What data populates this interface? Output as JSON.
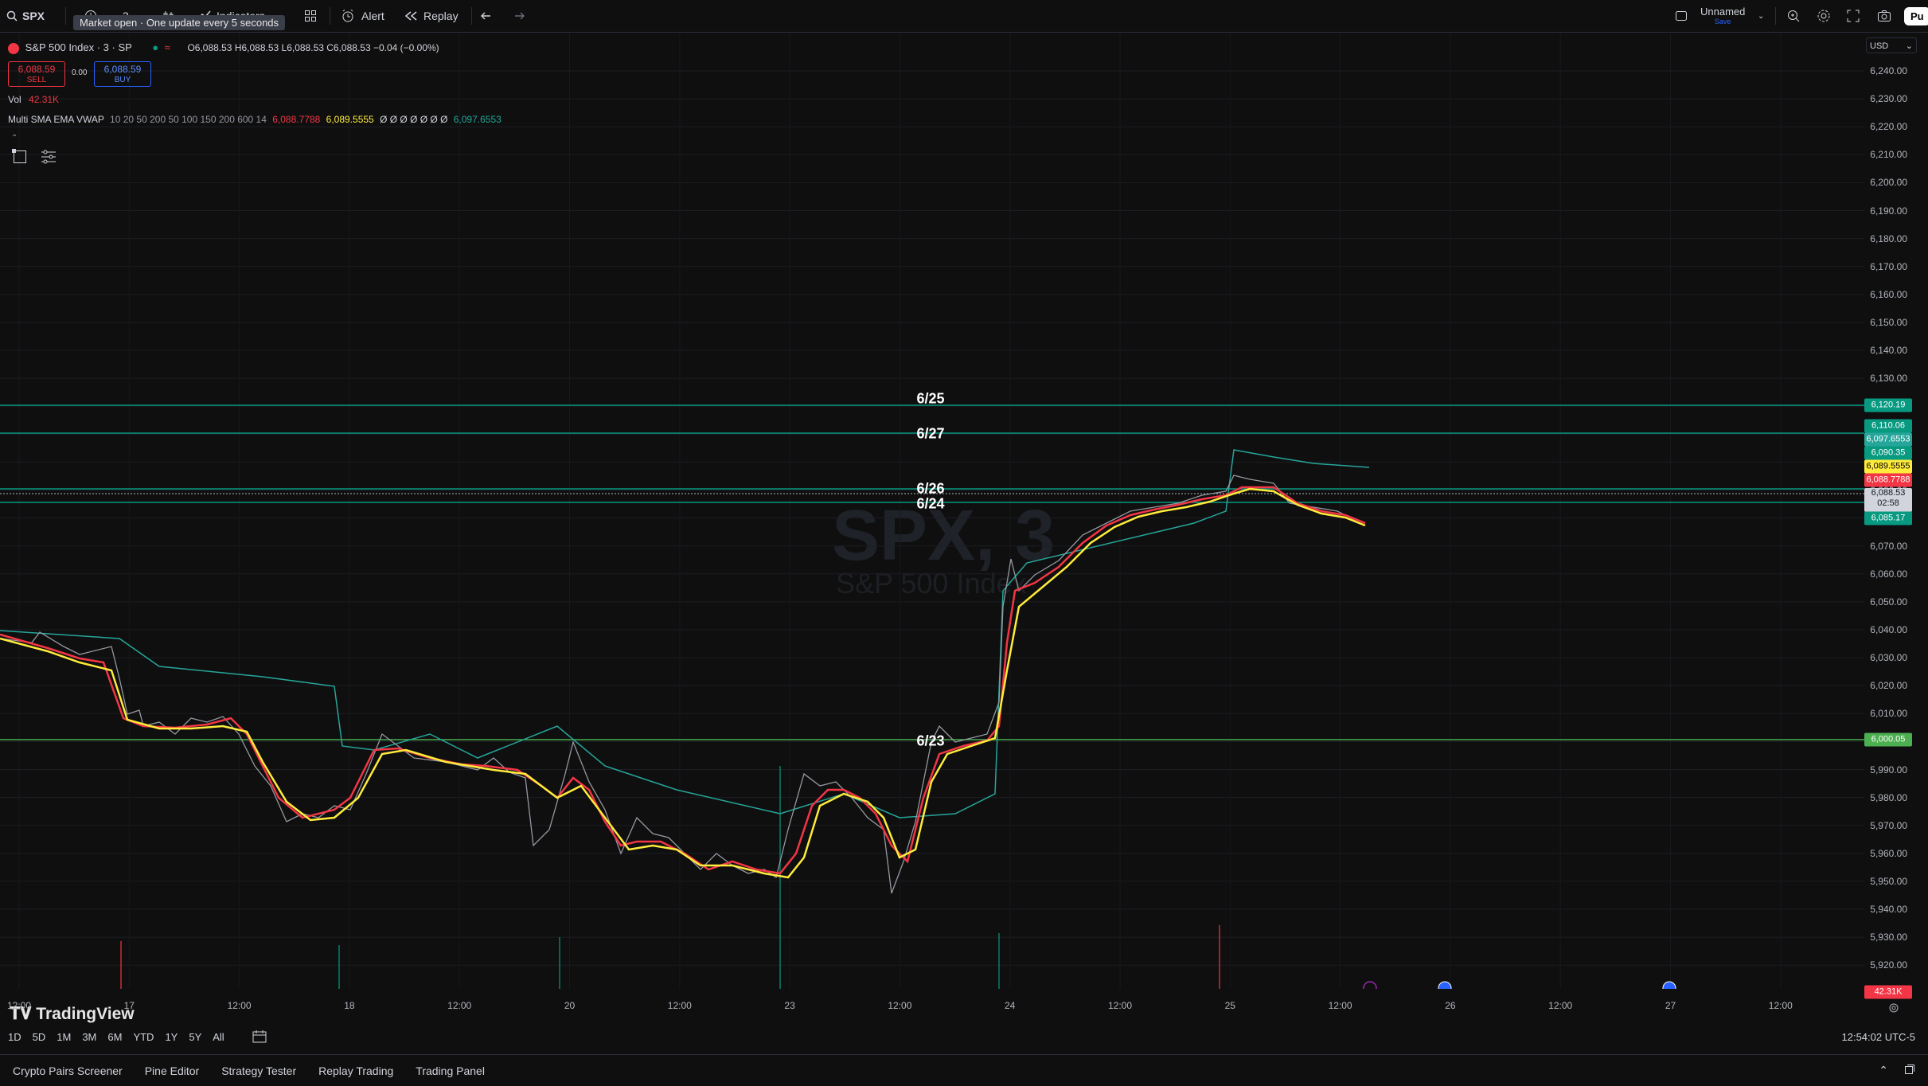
{
  "topbar": {
    "symbol": "SPX",
    "interval": "3",
    "indicators_label": "Indicators",
    "alert_label": "Alert",
    "replay_label": "Replay",
    "layout_name": "Unnamed",
    "save_label": "Save",
    "publish_label": "Pu",
    "tooltip": "Market open · One update every 5 seconds"
  },
  "legend": {
    "title": "S&P 500 Index · 3 · SP",
    "ohlc": "O6,088.53 H6,088.53 L6,088.53 C6,088.53 −0.04 (−0.00%)",
    "sell_price": "6,088.59",
    "sell_label": "SELL",
    "spread": "0.00",
    "buy_price": "6,088.59",
    "buy_label": "BUY",
    "vol_label": "Vol",
    "vol_value": "42.31K",
    "indicator_name": "Multi SMA EMA VWAP",
    "indicator_params": "10 20 50 200 50 100 150 200 600 14",
    "ind_val_red": "6,088.7788",
    "ind_val_yellow": "6,089.5555",
    "ind_val_empty": "Ø Ø Ø Ø Ø Ø Ø",
    "ind_val_teal": "6,097.6553"
  },
  "watermark": {
    "symbol": "SPX, 3",
    "name": "S&P 500 Index"
  },
  "currency": "USD",
  "price_axis": {
    "ticks": [
      "6,240.00",
      "6,230.00",
      "6,220.00",
      "6,210.00",
      "6,200.00",
      "6,190.00",
      "6,180.00",
      "6,170.00",
      "6,160.00",
      "6,150.00",
      "6,140.00",
      "6,130.00",
      "6,120.00",
      "6,110.00",
      "6,100.00",
      "6,090.00",
      "6,080.00",
      "6,070.00",
      "6,060.00",
      "6,050.00",
      "6,040.00",
      "6,030.00",
      "6,020.00",
      "6,010.00",
      "6,000.00",
      "5,990.00",
      "5,980.00",
      "5,970.00",
      "5,960.00",
      "5,950.00",
      "5,940.00",
      "5,930.00",
      "5,920.00"
    ]
  },
  "price_labels": {
    "l1": "6,120.19",
    "l2": "6,110.06",
    "l3": "6,097.6553",
    "l4": "6,090.35",
    "l5": "6,089.5555",
    "l6": "6,088.7788",
    "l7": "6,088.53",
    "l7b": "02:58",
    "l8": "6,085.17",
    "l9": "6,000.05",
    "l10": "42.31K"
  },
  "horizontal_lines": {
    "h1": "6/25",
    "h2": "6/27",
    "h3": "6/26",
    "h4": "6/24",
    "h5": "6/23"
  },
  "time_axis": [
    "12:00",
    "17",
    "12:00",
    "18",
    "12:00",
    "20",
    "12:00",
    "23",
    "12:00",
    "24",
    "12:00",
    "25",
    "12:00",
    "26",
    "12:00",
    "27",
    "12:00"
  ],
  "range_buttons": [
    "1D",
    "5D",
    "1M",
    "3M",
    "6M",
    "YTD",
    "1Y",
    "5Y",
    "All"
  ],
  "clock": "12:54:02 UTC-5",
  "bottom_tabs": [
    "Crypto Pairs Screener",
    "Pine Editor",
    "Strategy Tester",
    "Replay Trading",
    "Trading Panel"
  ],
  "brand": "TradingView",
  "colors": {
    "teal": "#089981",
    "red": "#f23645",
    "yellow": "#ffeb3b",
    "green": "#4caf50",
    "blue": "#2962ff"
  }
}
